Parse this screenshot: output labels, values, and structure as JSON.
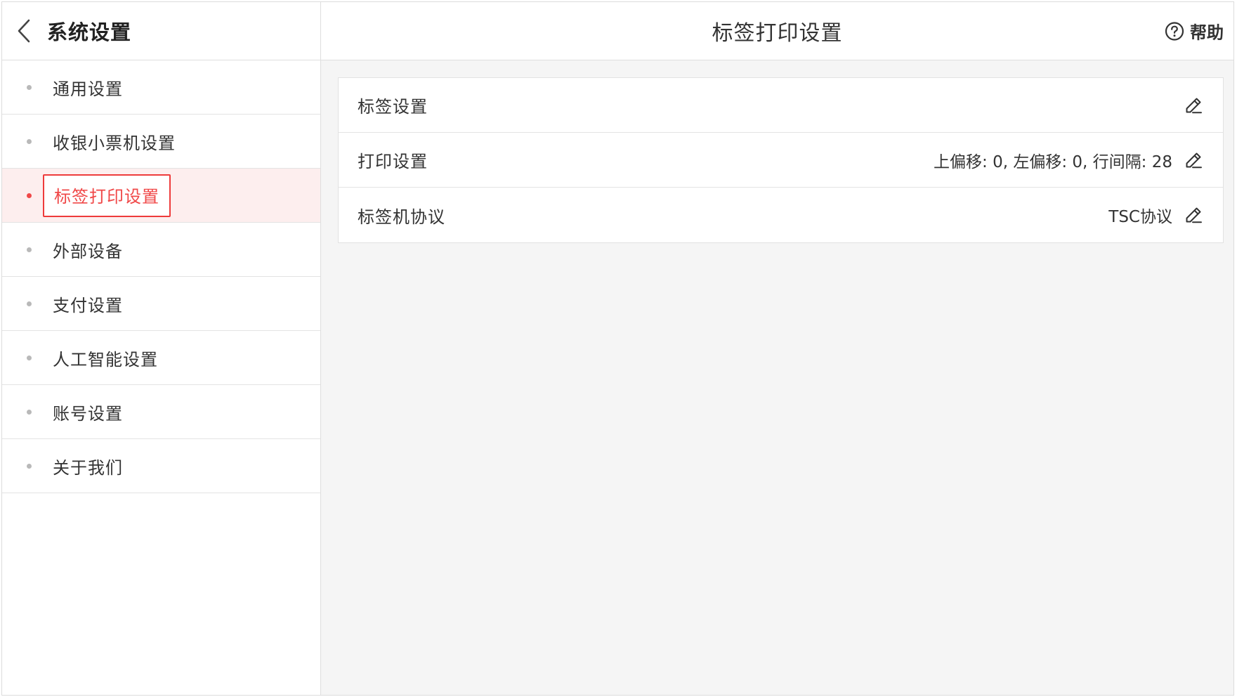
{
  "sidebar": {
    "title": "系统设置",
    "back_icon": "chevron-left-icon",
    "items": [
      {
        "label": "通用设置",
        "active": false
      },
      {
        "label": "收银小票机设置",
        "active": false
      },
      {
        "label": "标签打印设置",
        "active": true
      },
      {
        "label": "外部设备",
        "active": false
      },
      {
        "label": "支付设置",
        "active": false
      },
      {
        "label": "人工智能设置",
        "active": false
      },
      {
        "label": "账号设置",
        "active": false
      },
      {
        "label": "关于我们",
        "active": false
      }
    ]
  },
  "header": {
    "title": "标签打印设置",
    "help_label": "帮助",
    "help_icon": "question-circle-icon"
  },
  "settings": {
    "rows": [
      {
        "label": "标签设置",
        "value": "",
        "icon": "pencil-icon"
      },
      {
        "label": "打印设置",
        "value": "上偏移: 0, 左偏移: 0, 行间隔: 28",
        "icon": "pencil-icon"
      },
      {
        "label": "标签机协议",
        "value": "TSC协议",
        "icon": "pencil-icon"
      }
    ]
  },
  "colors": {
    "accent": "#f04848",
    "active_bg": "#fdeeee",
    "content_bg": "#f5f5f5",
    "dot_inactive": "#b9b9b9"
  }
}
